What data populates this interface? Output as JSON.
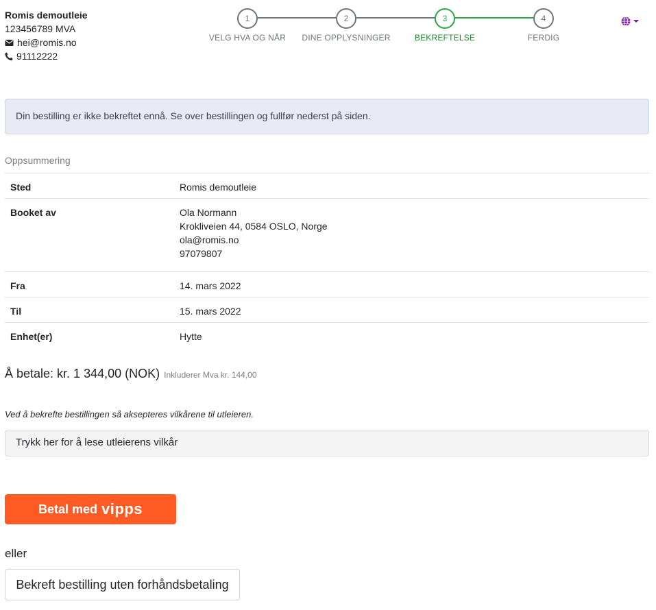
{
  "company": {
    "name": "Romis demoutleie",
    "org_number": "123456789 MVA",
    "email": "hei@romis.no",
    "phone": "91112222"
  },
  "stepper": {
    "steps": [
      {
        "number": "1",
        "label": "VELG HVA OG NÅR"
      },
      {
        "number": "2",
        "label": "DINE OPPLYSNINGER"
      },
      {
        "number": "3",
        "label": "BEKREFTELSE"
      },
      {
        "number": "4",
        "label": "FERDIG"
      }
    ],
    "active_index": 2,
    "active_color": "#28a745"
  },
  "language_menu": {
    "icon": "globe-icon"
  },
  "alert": {
    "text": "Din bestilling er ikke bekreftet ennå. Se over bestillingen og fullfør nederst på siden."
  },
  "summary": {
    "title": "Oppsummering",
    "rows": [
      {
        "label": "Sted",
        "lines": [
          "Romis demoutleie"
        ]
      },
      {
        "label": "Booket av",
        "lines": [
          "Ola Normann",
          "Krokliveien 44, 0584 OSLO, Norge",
          "ola@romis.no",
          "97079807"
        ]
      },
      {
        "label": "Fra",
        "lines": [
          "14. mars 2022"
        ]
      },
      {
        "label": "Til",
        "lines": [
          "15. mars 2022"
        ]
      },
      {
        "label": "Enhet(er)",
        "lines": [
          "Hytte"
        ]
      }
    ]
  },
  "payment": {
    "total_text": "Å betale: kr. 1 344,00 (NOK)",
    "vat_text": "Inkluderer Mva kr. 144,00"
  },
  "terms": {
    "note": "Ved å bekrefte bestillingen så aksepteres vilkårene til utleieren.",
    "link_text": "Trykk her for å lese utleierens vilkår"
  },
  "actions": {
    "vipps_label": "Betal med",
    "vipps_brand": "vipps",
    "vipps_color": "#fe5b24",
    "or_text": "eller",
    "confirm_label": "Bekreft bestilling uten forhåndsbetaling"
  }
}
